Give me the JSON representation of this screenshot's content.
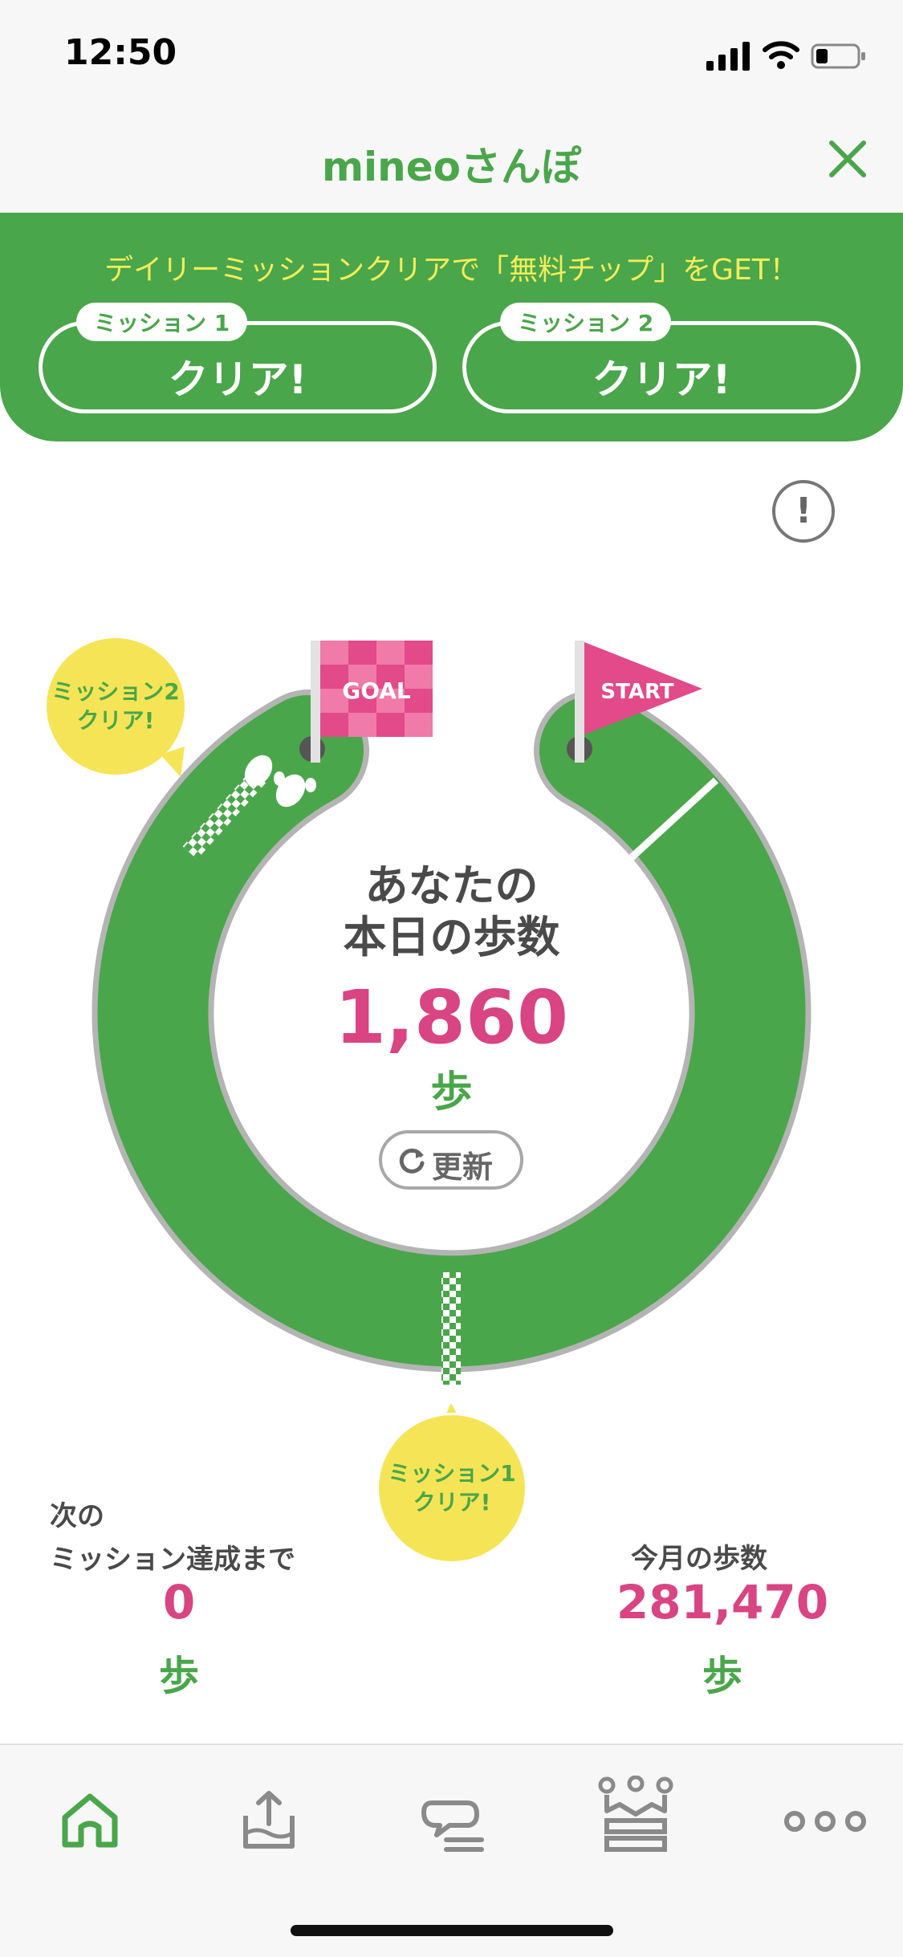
{
  "status_bar": {
    "time": "12:50",
    "icons": [
      "signal-icon",
      "wifi-icon",
      "battery-icon"
    ]
  },
  "header": {
    "title": "mineoさんぽ",
    "close_icon": "close-icon"
  },
  "banner": {
    "text": "デイリーミッションクリアで「無料チップ」をGET！",
    "missions": [
      {
        "tag": "ミッション 1",
        "status": "クリア!"
      },
      {
        "tag": "ミッション 2",
        "status": "クリア!"
      }
    ]
  },
  "course": {
    "goal_flag": "GOAL",
    "start_flag": "START",
    "mission2_bubble": "ミッション2\nクリア!",
    "mission1_bubble": "ミッション1\nクリア!",
    "center_label": "あなたの\n本日の歩数",
    "today_steps": "1,860",
    "today_unit": "歩",
    "refresh_label": "更新"
  },
  "next_mission": {
    "label": "次の\nミッション達成まで",
    "value": "0",
    "unit": "歩"
  },
  "monthly": {
    "label": "今月の歩数",
    "value": "281,470",
    "unit": "歩"
  },
  "tab_bar": {
    "icons": [
      "home-icon",
      "upload-icon",
      "chat-icon",
      "ranking-crown-icon",
      "more-icon"
    ],
    "active": "home-icon"
  },
  "colors": {
    "green": "#4aa64a",
    "pink": "#d94482",
    "yellow": "#f5e556",
    "banner_text": "#f4ec5a"
  }
}
